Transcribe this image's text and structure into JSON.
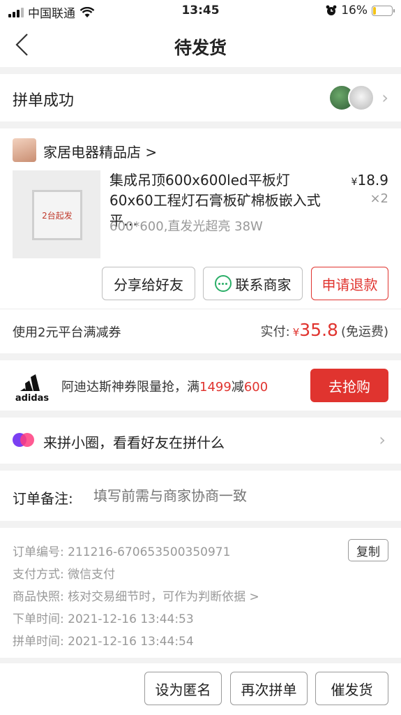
{
  "status_bar": {
    "carrier": "中国联通",
    "time": "13:45",
    "battery": "16%",
    "battery_level": 0.16
  },
  "nav": {
    "title": "待发货"
  },
  "pin": {
    "label": "拼单成功"
  },
  "shop": {
    "name": "家居电器精品店 >"
  },
  "product": {
    "image_text": "2台起发",
    "title": "集成吊顶600x600led平板灯60x60工程灯石膏板矿棉板嵌入式平…",
    "spec": "600*600,直发光超亮 38W",
    "price_symbol": "¥",
    "price": "18.9",
    "qty": "×2"
  },
  "actions": {
    "share": "分享给好友",
    "contact": "联系商家",
    "refund": "申请退款"
  },
  "payment": {
    "coupon": "使用2元平台满减券",
    "paid_label": "实付:",
    "currency": "¥",
    "amount": "35.8",
    "shipping": "(免运费)"
  },
  "ad": {
    "logo_text": "adidas",
    "text_before": "阿迪达斯神券限量抢，满",
    "highlight_1": "1499",
    "text_mid": "减",
    "highlight_2": "600",
    "button": "去抢购"
  },
  "circle": {
    "label": "来拼小圈，看看好友在拼什么"
  },
  "remark": {
    "label": "订单备注:",
    "placeholder": "填写前需与商家协商一致"
  },
  "info": {
    "order_no": "订单编号:  211216-670653500350971",
    "pay_method": "支付方式:  微信支付",
    "snapshot": "商品快照:  核对交易细节时，可作为判断依据 >",
    "order_time": "下单时间:  2021-12-16 13:44:53",
    "pin_time": "拼单时间:  2021-12-16 13:44:54",
    "copy": "复制"
  },
  "bottom": {
    "anonymous": "设为匿名",
    "again": "再次拼单",
    "urge": "催发货"
  },
  "colors": {
    "accent": "#e0342f",
    "wechat_green": "#2aae67",
    "battery_low": "#f3c316"
  },
  "icons": [
    "signal-icon",
    "wifi-icon",
    "alarm-icon",
    "battery-icon",
    "back-chevron-icon",
    "chevron-right-icon",
    "wechat-chat-icon",
    "adidas-logo",
    "circle-icon"
  ]
}
